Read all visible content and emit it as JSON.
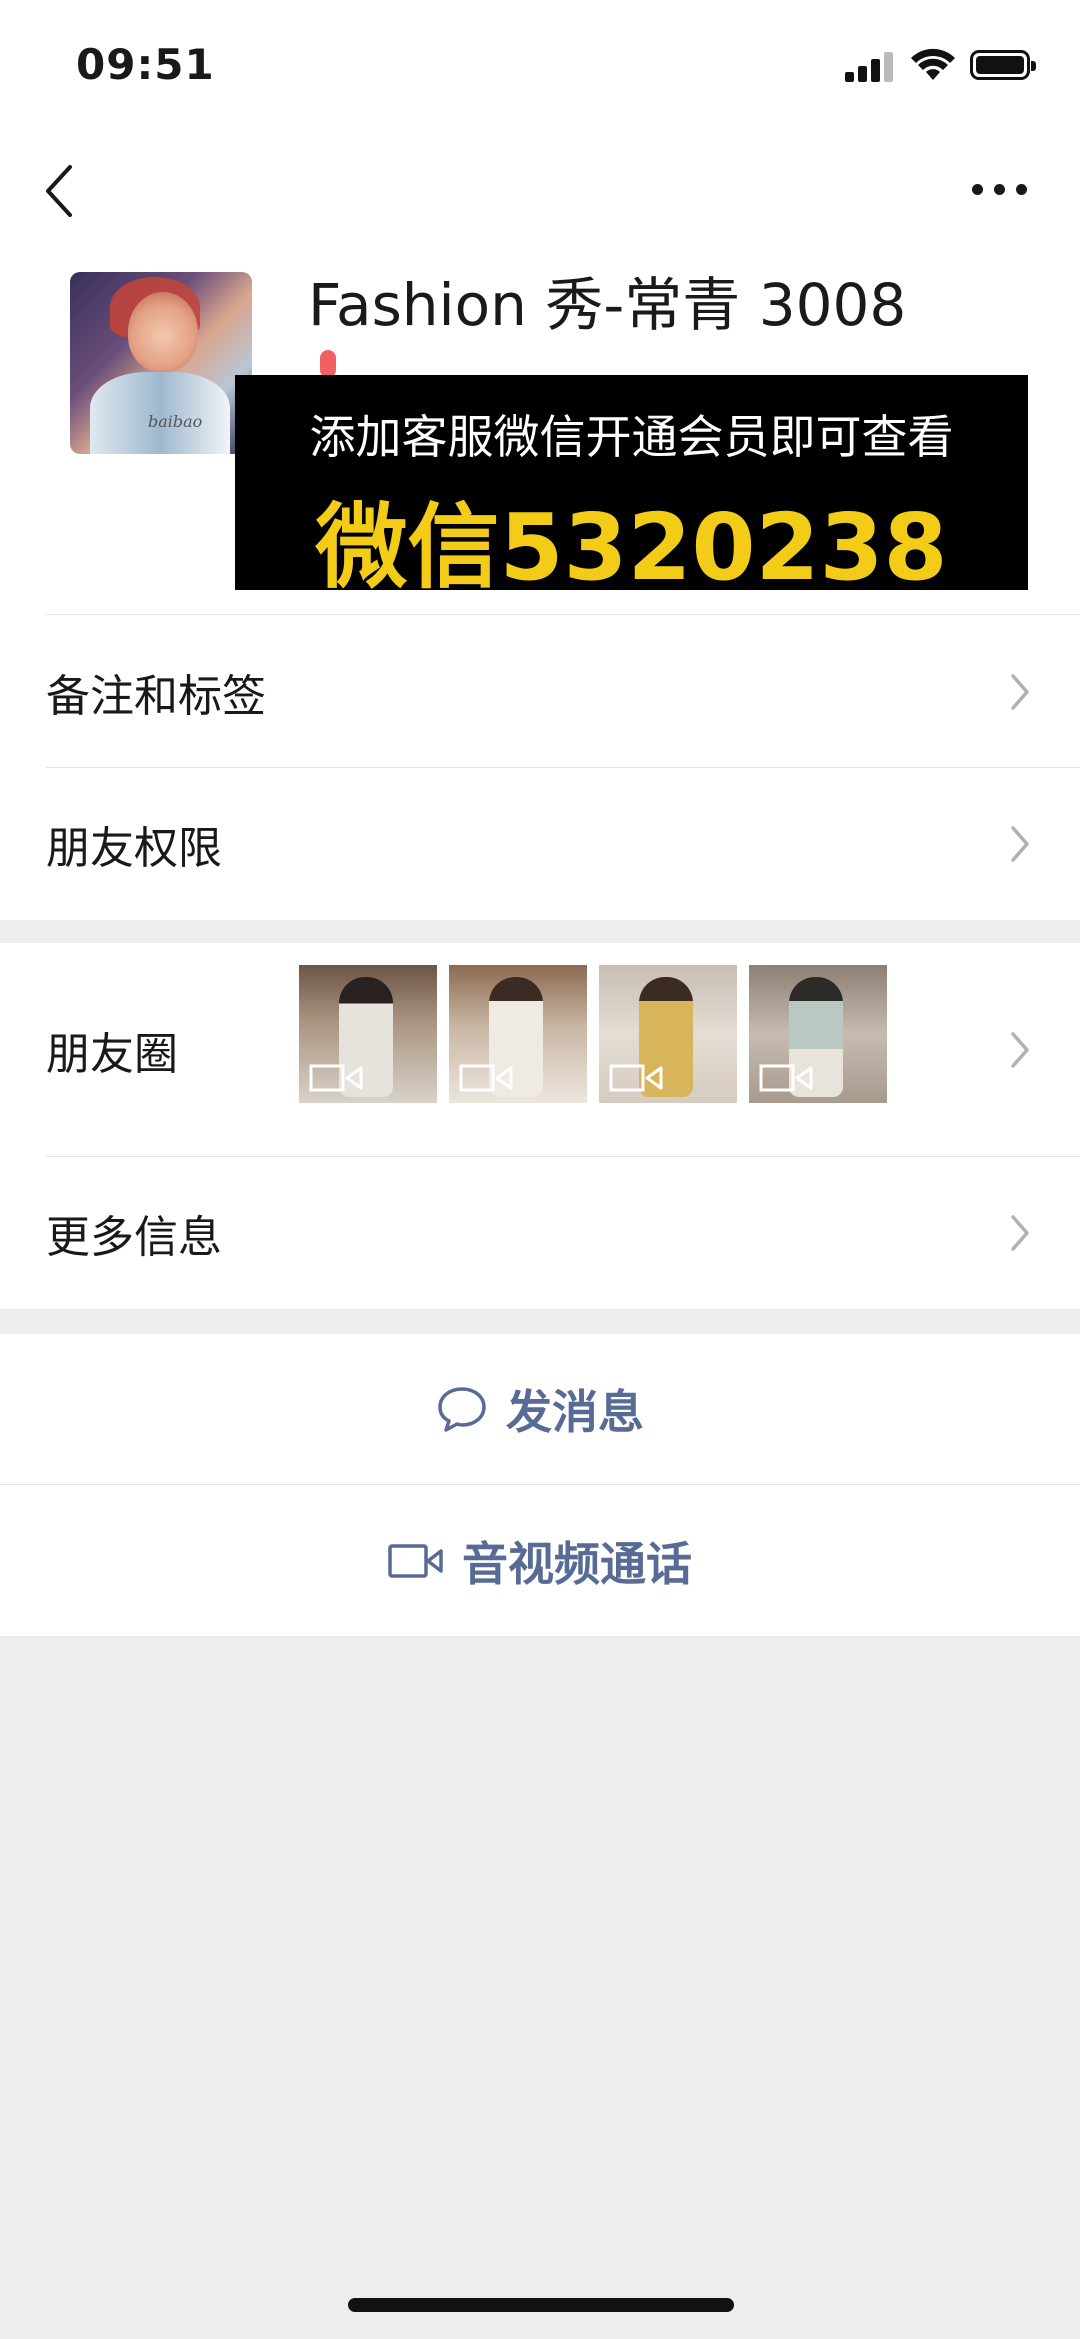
{
  "status_bar": {
    "time": "09:51"
  },
  "profile": {
    "name": "Fashion 秀-常青 3008",
    "avatar_label": "baibao"
  },
  "ad_banner": {
    "line1": "添加客服微信开通会员即可查看",
    "line2": "微信5320238"
  },
  "menu": {
    "remarks_tags": "备注和标签",
    "friend_permissions": "朋友权限",
    "moments": "朋友圈",
    "more_info": "更多信息"
  },
  "moments_thumbnails": [
    {
      "icon": "video-icon"
    },
    {
      "icon": "video-icon"
    },
    {
      "icon": "video-icon"
    },
    {
      "icon": "video-icon"
    }
  ],
  "actions": {
    "send_message": "发消息",
    "video_call": "音视频通话"
  },
  "colors": {
    "link_blue": "#576b95",
    "ad_yellow": "#f3cc18",
    "background": "#ededed"
  }
}
